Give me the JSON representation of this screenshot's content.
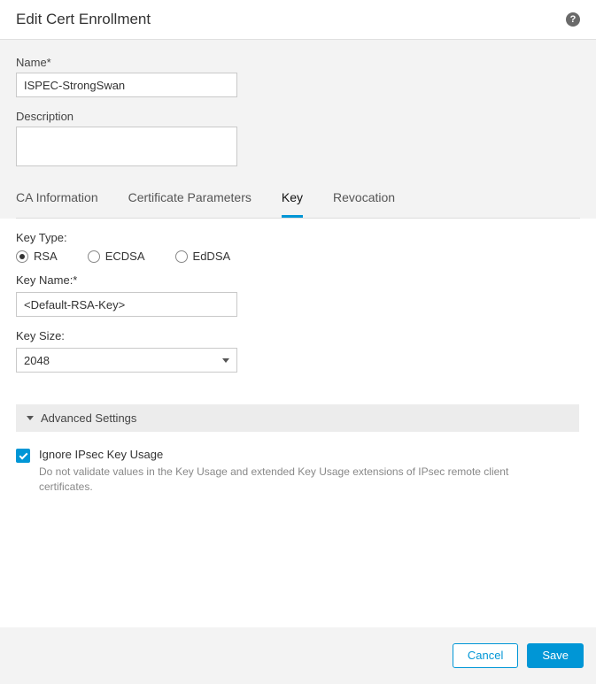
{
  "header": {
    "title": "Edit Cert Enrollment"
  },
  "form": {
    "name_label": "Name*",
    "name_value": "ISPEC-StrongSwan",
    "description_label": "Description",
    "description_value": ""
  },
  "tabs": {
    "items": [
      {
        "label": "CA Information",
        "active": false
      },
      {
        "label": "Certificate Parameters",
        "active": false
      },
      {
        "label": "Key",
        "active": true
      },
      {
        "label": "Revocation",
        "active": false
      }
    ]
  },
  "key": {
    "type_label": "Key Type:",
    "options": [
      {
        "label": "RSA",
        "selected": true
      },
      {
        "label": "ECDSA",
        "selected": false
      },
      {
        "label": "EdDSA",
        "selected": false
      }
    ],
    "name_label": "Key Name:*",
    "name_value": "<Default-RSA-Key>",
    "size_label": "Key Size:",
    "size_value": "2048"
  },
  "advanced": {
    "title": "Advanced Settings",
    "ignore_label": "Ignore IPsec Key Usage",
    "ignore_checked": true,
    "ignore_desc": "Do not validate values in the Key Usage and extended Key Usage extensions of IPsec remote client certificates."
  },
  "footer": {
    "cancel": "Cancel",
    "save": "Save"
  }
}
